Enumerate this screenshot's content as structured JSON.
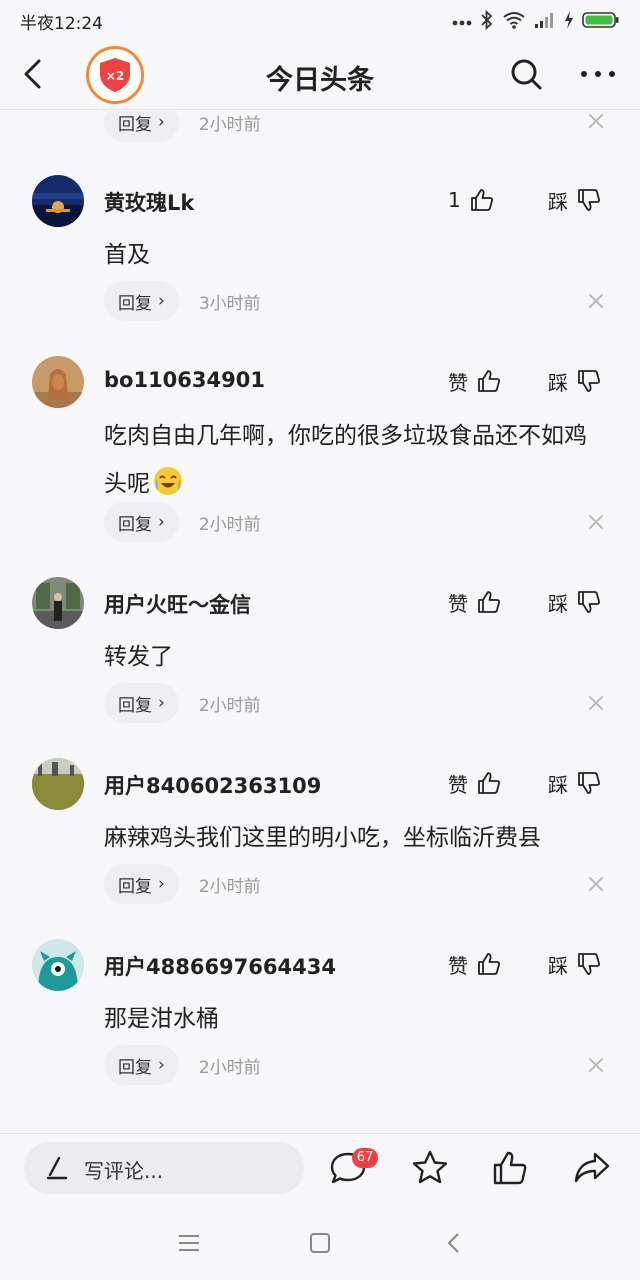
{
  "status_bar": {
    "time": "半夜12:24"
  },
  "header": {
    "title": "今日头条",
    "badge_text": "×2",
    "icons": [
      "back-icon",
      "search-icon",
      "more-icon"
    ]
  },
  "top_partial": {
    "reply_label": "回复",
    "time": "2小时前"
  },
  "comments": [
    {
      "username": "黄玫瑰Lk",
      "like_label": "1",
      "dislike_label": "踩",
      "text": "首及",
      "reply_label": "回复",
      "time": "3小时前"
    },
    {
      "username": "bo110634901",
      "like_label": "赞",
      "dislike_label": "踩",
      "text": "吃肉自由几年啊，你吃的很多垃圾食品还不如鸡头呢",
      "emoji": "crying-laughing-emoji",
      "reply_label": "回复",
      "time": "2小时前"
    },
    {
      "username": "用户火旺～金信",
      "like_label": "赞",
      "dislike_label": "踩",
      "text": "转发了",
      "reply_label": "回复",
      "time": "2小时前"
    },
    {
      "username": "用户840602363109",
      "like_label": "赞",
      "dislike_label": "踩",
      "text": "麻辣鸡头我们这里的明小吃，坐标临沂费县",
      "reply_label": "回复",
      "time": "2小时前"
    },
    {
      "username": "用户4886697664434",
      "like_label": "赞",
      "dislike_label": "踩",
      "text": "那是泔水桶",
      "reply_label": "回复",
      "time": "2小时前"
    }
  ],
  "bottom_bar": {
    "placeholder": "写评论...",
    "comment_count": "67",
    "icons": [
      "pen-icon",
      "comment-icon",
      "star-icon",
      "thumbs-up-icon",
      "share-icon"
    ]
  },
  "colors": {
    "accent_red": "#f04142",
    "badge_orange": "#f08a3a",
    "background": "#f7f7f9"
  }
}
